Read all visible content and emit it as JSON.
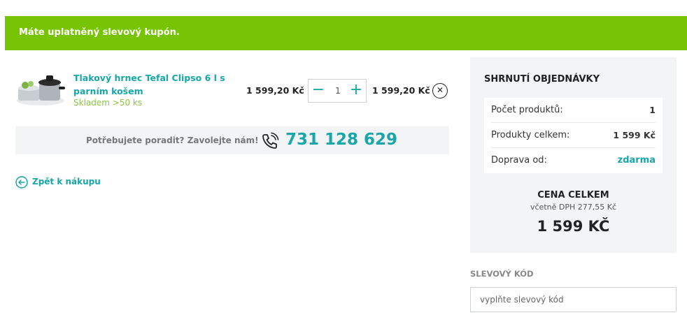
{
  "banner": {
    "message": "Máte uplatněný slevový kupón."
  },
  "cart": {
    "item": {
      "name": "Tlakový hrnec Tefal Clipso 6 l s parním košem",
      "stock": "Skladem >50 ks",
      "unit_price": "1 599,20 Kč",
      "quantity": "1",
      "total_price": "1 599,20 Kč",
      "minus_label": "−",
      "plus_label": "+",
      "remove_label": "✕"
    },
    "help": {
      "text": "Potřebujete poradit? Zavolejte nám!",
      "phone": "731 128 629"
    },
    "back_label": "Zpět k nákupu"
  },
  "summary": {
    "title": "SHRNUTÍ OBJEDNÁVKY",
    "rows": [
      {
        "label": "Počet produktů:",
        "value": "1"
      },
      {
        "label": "Produkty celkem:",
        "value": "1 599 Kč"
      },
      {
        "label": "Doprava od:",
        "value": "zdarma"
      }
    ],
    "total_label": "CENA CELKEM",
    "vat_note": "včetně DPH 277,55 Kč",
    "total_value": "1 599 KČ"
  },
  "coupon": {
    "label": "SLEVOVÝ KÓD",
    "placeholder": "vyplňte slevový kód",
    "value": ""
  },
  "colors": {
    "banner_green": "#76c403",
    "accent_teal": "#18a6a9",
    "stock_green": "#8bc34a",
    "panel_gray": "#f2f4f6"
  },
  "icons": [
    "product-thumbnail",
    "phone-icon",
    "back-arrow-icon",
    "close-icon"
  ]
}
